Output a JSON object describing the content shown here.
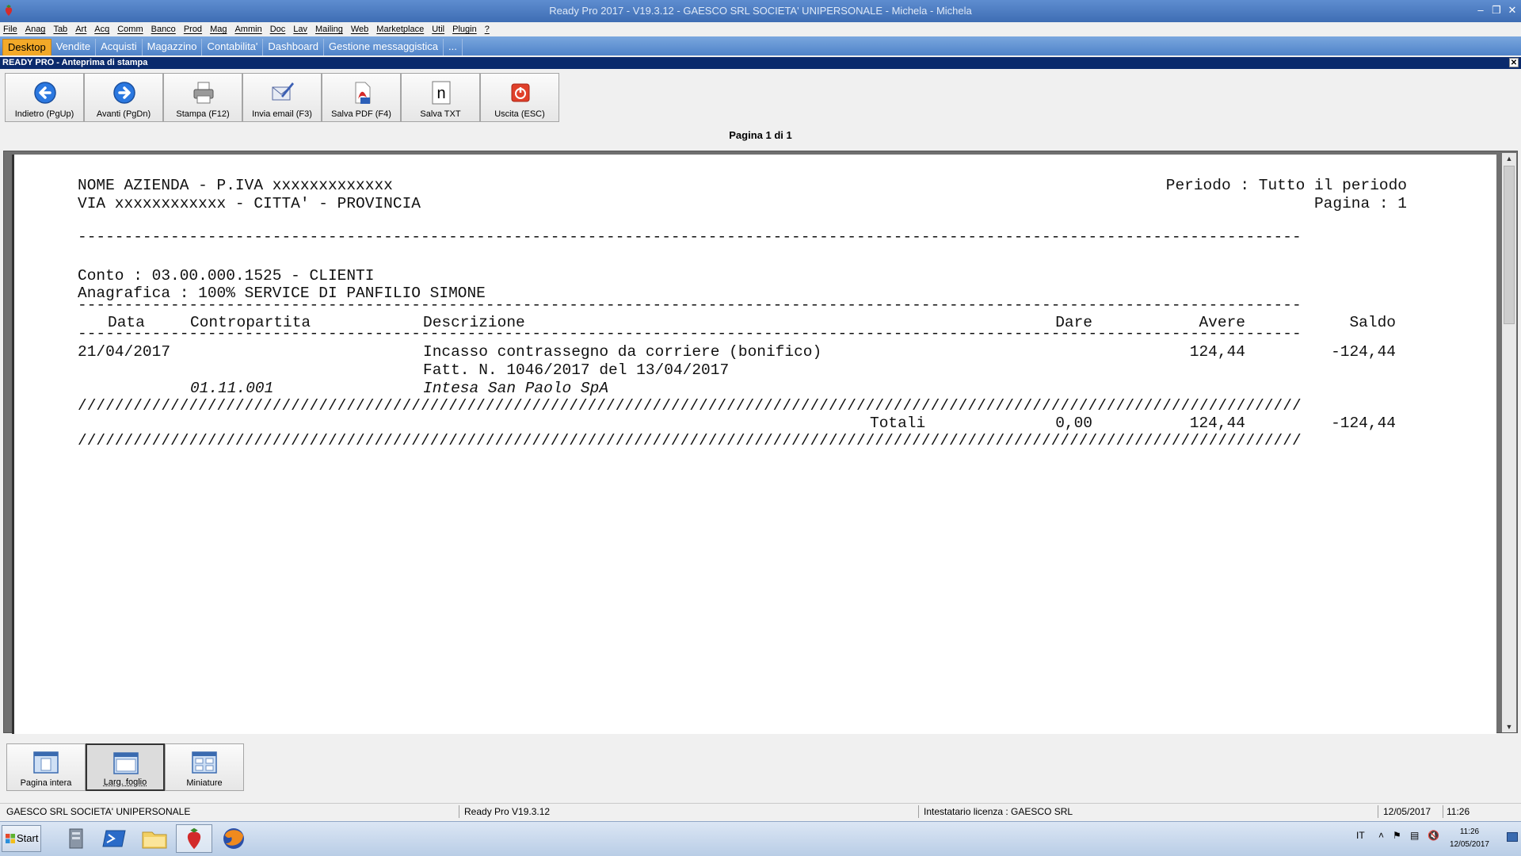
{
  "window": {
    "title": "Ready Pro 2017 - V19.3.12 - GAESCO SRL SOCIETA' UNIPERSONALE - Michela - Michela"
  },
  "menu": [
    "File",
    "Anag",
    "Tab",
    "Art",
    "Acq",
    "Comm",
    "Banco",
    "Prod",
    "Mag",
    "Ammin",
    "Doc",
    "Lav",
    "Mailing",
    "Web",
    "Marketplace",
    "Util",
    "Plugin",
    "?"
  ],
  "tabs": [
    "Desktop",
    "Vendite",
    "Acquisti",
    "Magazzino",
    "Contabilita'",
    "Dashboard",
    "Gestione messaggistica",
    "..."
  ],
  "panel": {
    "caption": "READY PRO - Anteprima di stampa"
  },
  "toolbar": [
    {
      "label": "Indietro (PgUp)",
      "icon": "arrow-left-icon"
    },
    {
      "label": "Avanti (PgDn)",
      "icon": "arrow-right-icon"
    },
    {
      "label": "Stampa (F12)",
      "icon": "printer-icon"
    },
    {
      "label": "Invia email (F3)",
      "icon": "email-icon"
    },
    {
      "label": "Salva PDF (F4)",
      "icon": "pdf-icon"
    },
    {
      "label": "Salva TXT",
      "icon": "txt-icon"
    },
    {
      "label": "Uscita (ESC)",
      "icon": "exit-icon"
    }
  ],
  "page_info": "Pagina 1 di 1",
  "report": {
    "company_line1": "NOME AZIENDA - P.IVA xxxxxxxxxxxxx",
    "company_line2": "VIA xxxxxxxxxxxx - CITTA' - PROVINCIA",
    "period_line": "Periodo : Tutto il periodo",
    "page_line": "Pagina : 1",
    "separator": "------------------------------------------------------------------------------------------------------------------------------------",
    "conto": "Conto : 03.00.000.1525 - CLIENTI",
    "anagrafica": "Anagrafica : 100% SERVICE DI PANFILIO SIMONE",
    "col_data": "Data",
    "col_contropartita": "Contropartita",
    "col_descrizione": "Descrizione",
    "col_dare": "Dare",
    "col_avere": "Avere",
    "col_saldo": "Saldo",
    "row_date": "21/04/2017",
    "row_desc1": "Incasso contrassegno da corriere (bonifico)",
    "row_desc2": "Fatt. N. 1046/2017 del 13/04/2017",
    "row_contro": "01.11.001",
    "row_contro_name": "Intesa San Paolo SpA",
    "row_avere": "124,44",
    "row_saldo": "-124,44",
    "slash_line": "////////////////////////////////////////////////////////////////////////////////////////////////////////////////////////////////////",
    "totali_label": "Totali",
    "tot_dare": "0,00",
    "tot_avere": "124,44",
    "tot_saldo": "-124,44"
  },
  "view_buttons": [
    {
      "label": "Pagina intera",
      "selected": false
    },
    {
      "label": "Larg. foglio",
      "selected": true
    },
    {
      "label": "Miniature",
      "selected": false
    }
  ],
  "status": {
    "company": "GAESCO SRL SOCIETA' UNIPERSONALE",
    "version": "Ready Pro V19.3.12",
    "license": "Intestatario licenza : GAESCO SRL",
    "date": "12/05/2017",
    "time": "11:26"
  },
  "taskbar": {
    "start": "Start",
    "lang": "IT",
    "clock_time": "11:26",
    "clock_date": "12/05/2017"
  }
}
